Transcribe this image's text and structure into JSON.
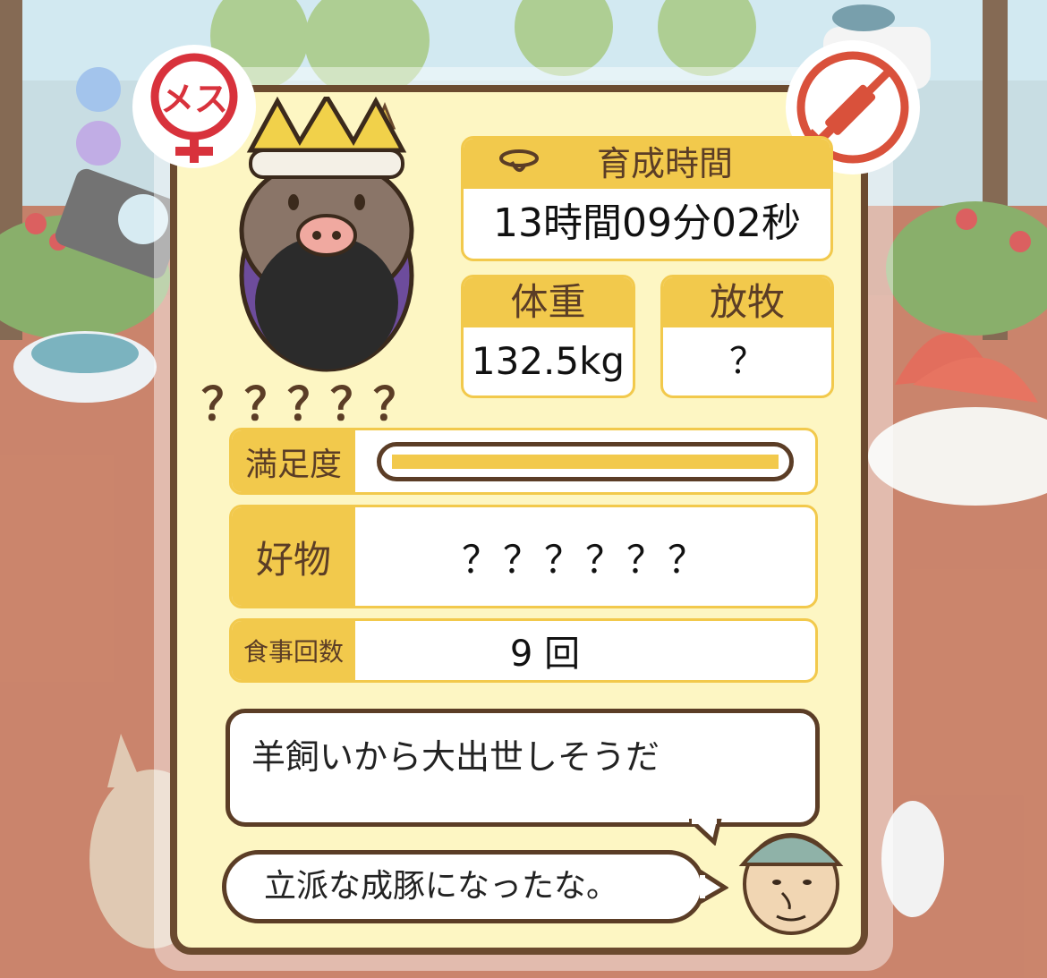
{
  "pig": {
    "gender_label": "メス",
    "name": "？？？？？"
  },
  "stats": {
    "time": {
      "label": "育成時間",
      "value": "13時間09分02秒"
    },
    "weight": {
      "label": "体重",
      "value": "132.5kg"
    },
    "pasture": {
      "label": "放牧",
      "value": "？"
    }
  },
  "satisfaction": {
    "label": "満足度",
    "level": 1.0
  },
  "favorite": {
    "label": "好物",
    "value": "？？？？？？"
  },
  "meals": {
    "label": "食事回数",
    "value": "9 回"
  },
  "comment": "羊飼いから大出世しそうだ",
  "farmer_says": "立派な成豚になったな。",
  "colors": {
    "accent": "#f2c94c",
    "border": "#6b4a2f",
    "panel": "#fdf6c3",
    "gender": "#d8323c",
    "no_injection": "#d9513b"
  },
  "icons": [
    "female-icon",
    "no-injection-icon",
    "stopwatch-icon",
    "farmer-avatar-icon"
  ]
}
